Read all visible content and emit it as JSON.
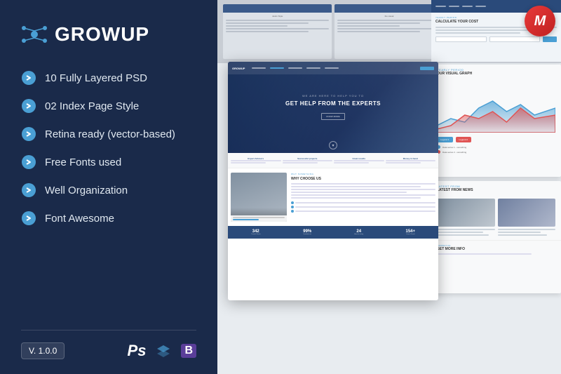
{
  "brand": {
    "name": "GROWUP",
    "logo_color": "#4a9fd4"
  },
  "features": [
    {
      "id": "feat-1",
      "label": "10 Fully Layered PSD"
    },
    {
      "id": "feat-2",
      "label": "02 Index Page Style"
    },
    {
      "id": "feat-3",
      "label": "Retina ready (vector-based)"
    },
    {
      "id": "feat-4",
      "label": "Free Fonts used"
    },
    {
      "id": "feat-5",
      "label": "Well Organization"
    },
    {
      "id": "feat-6",
      "label": "Font Awesome"
    }
  ],
  "version": "V. 1.0.0",
  "hero_text": {
    "small": "WE ARE HERE TO HELP YOU TO",
    "big": "GET HELP FROM THE EXPERTS",
    "btn": "KNOW MORE"
  },
  "stats_row": [
    {
      "title": "Expert Advisors",
      "desc": "Lorem ipsum dolor sit"
    },
    {
      "title": "Successful projects",
      "desc": "Lorem ipsum dolor sit"
    },
    {
      "title": "Great results",
      "desc": "Lorem ipsum dolor sit"
    },
    {
      "title": "Money in hand",
      "desc": "Lorem ipsum dolor sit"
    }
  ],
  "content_section": {
    "eyebrow": "WHY SOMETHING",
    "title": "WHY CHOOSE US"
  },
  "counter_bar": [
    {
      "num": "342",
      "label": "Trusted Clients"
    },
    {
      "num": "99%",
      "label": "Satisfied  rate"
    },
    {
      "num": "24",
      "label": "Awards wining"
    },
    {
      "num": "154+",
      "label": "Cases Closed"
    }
  ],
  "graph_section": {
    "eyebrow": "YEARLY PERIOD",
    "title": "OUR VISUAL GRAPH",
    "legend": [
      {
        "label": "Data series 1 - something",
        "color": "#4a9fd4"
      },
      {
        "label": "Data series 2 - something",
        "color": "#e05555"
      }
    ]
  },
  "news_section": {
    "eyebrow": "LATEST FROM",
    "title": "LATEST FROM NEWS"
  },
  "contact_section": {
    "eyebrow": "CONTACT US",
    "title": "GET MORE INFO"
  },
  "top_strip_pages": [
    {
      "label": "Justin Style"
    },
    {
      "label": "the visual"
    },
    {
      "label": "Martin Style"
    }
  ],
  "tools": {
    "ps": "Ps",
    "bootstrap": "B"
  }
}
